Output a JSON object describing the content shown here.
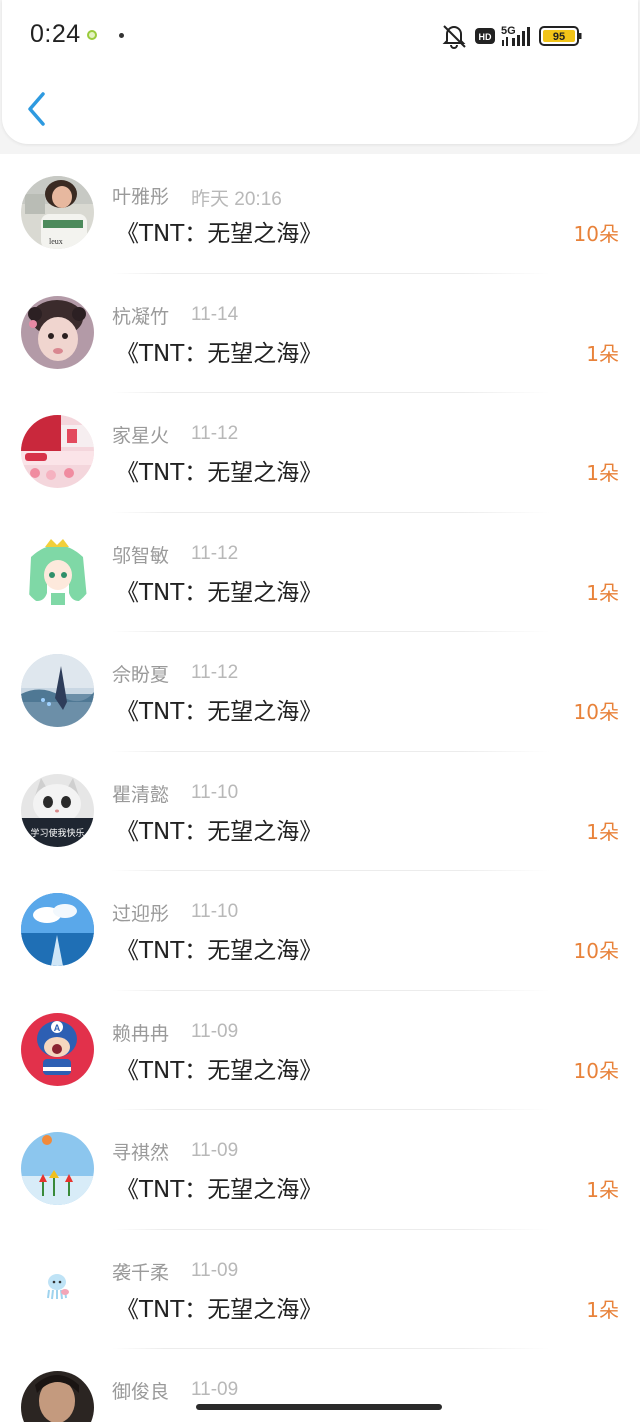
{
  "status_bar": {
    "time": "0:24",
    "network": "5G",
    "hd": "HD",
    "battery": "95"
  },
  "list": [
    {
      "name": "叶雅彤",
      "date": "昨天 20:16",
      "work": "《TNT：无望之海》",
      "count": "10朵",
      "avatar": "photo-avatar"
    },
    {
      "name": "杭凝竹",
      "date": "11-14",
      "work": "《TNT：无望之海》",
      "count": "1朵",
      "avatar": "photo-avatar"
    },
    {
      "name": "家星火",
      "date": "11-12",
      "work": "《TNT：无望之海》",
      "count": "1朵",
      "avatar": "photo-avatar"
    },
    {
      "name": "邬智敏",
      "date": "11-12",
      "work": "《TNT：无望之海》",
      "count": "1朵",
      "avatar": "anime-avatar"
    },
    {
      "name": "佘盼夏",
      "date": "11-12",
      "work": "《TNT：无望之海》",
      "count": "10朵",
      "avatar": "photo-avatar"
    },
    {
      "name": "瞿清懿",
      "date": "11-10",
      "work": "《TNT：无望之海》",
      "count": "1朵",
      "avatar": "cat-avatar",
      "avatar_caption": "学习使我快乐"
    },
    {
      "name": "过迎彤",
      "date": "11-10",
      "work": "《TNT：无望之海》",
      "count": "10朵",
      "avatar": "sky-avatar"
    },
    {
      "name": "赖冉冉",
      "date": "11-09",
      "work": "《TNT：无望之海》",
      "count": "10朵",
      "avatar": "cartoon-avatar"
    },
    {
      "name": "寻祺然",
      "date": "11-09",
      "work": "《TNT：无望之海》",
      "count": "1朵",
      "avatar": "tulip-avatar"
    },
    {
      "name": "袭千柔",
      "date": "11-09",
      "work": "《TNT：无望之海》",
      "count": "1朵",
      "avatar": "jellyfish-avatar"
    },
    {
      "name": "御俊良",
      "date": "11-09",
      "work": "",
      "count": "",
      "avatar": "photo-avatar"
    }
  ]
}
